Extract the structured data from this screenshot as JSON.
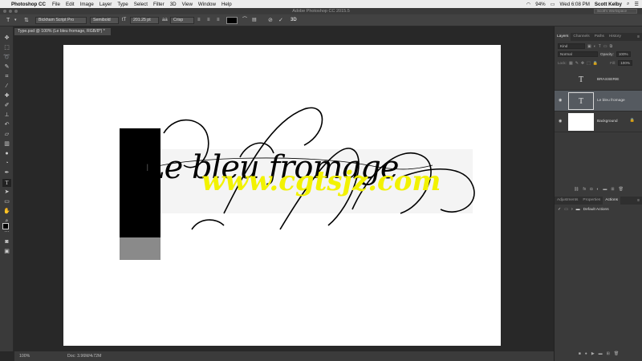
{
  "menubar": {
    "apple": "",
    "app_name": "Photoshop CC",
    "items": [
      "File",
      "Edit",
      "Image",
      "Layer",
      "Type",
      "Select",
      "Filter",
      "3D",
      "View",
      "Window",
      "Help"
    ],
    "battery": "94%",
    "clock": "Wed 6:08 PM",
    "user": "Scott Kelby"
  },
  "window": {
    "title": "Adobe Photoshop CC 2015.5",
    "workspace_search": "Scott's Workspace"
  },
  "options": {
    "font_family": "Bickham Script Pro",
    "font_style": "Semibold",
    "font_size": "201.25 pt",
    "antialias": "Crisp",
    "text_color": "#000000"
  },
  "document": {
    "tab_title": "Type.psd @ 100% (Le bleu fromage, RGB/8*) *",
    "canvas_text": "Le bleu fromage",
    "watermark": "www.cgtsjz.com",
    "zoom": "100%",
    "doc_size": "Doc: 3.96M/4.72M"
  },
  "layers_panel": {
    "tabs": [
      "Layers",
      "Channels",
      "Paths",
      "History"
    ],
    "active_tab": "Layers",
    "filter_label": "Kind",
    "blend_mode": "Normal",
    "opacity_label": "Opacity:",
    "opacity_value": "100%",
    "lock_label": "Lock:",
    "fill_label": "Fill:",
    "fill_value": "100%",
    "layers": [
      {
        "name": "BRASSERIE",
        "type": "text",
        "visible": false,
        "selected": false
      },
      {
        "name": "Le bleu fromage",
        "type": "text",
        "visible": true,
        "selected": true
      },
      {
        "name": "Background",
        "type": "pixel",
        "visible": true,
        "selected": false,
        "locked": true
      }
    ]
  },
  "actions_panel": {
    "tabs": [
      "Adjustments",
      "Properties",
      "Actions"
    ],
    "active_tab": "Actions",
    "items": [
      {
        "label": "Default Actions",
        "checked": true
      }
    ]
  },
  "colors": {
    "menubar_bg": "#ececec",
    "app_bg": "#282828",
    "panel_bg": "#3a3a3a",
    "selected_layer": "#555a60",
    "watermark": "#f2f200"
  }
}
